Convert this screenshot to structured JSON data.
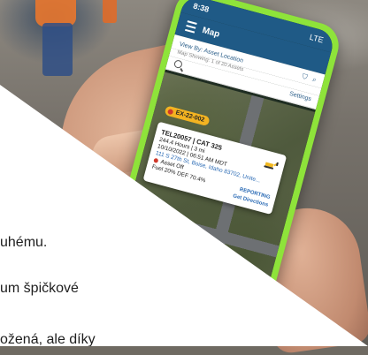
{
  "phone": {
    "status": {
      "time": "8:38",
      "signal": "LTE"
    },
    "appbar": {
      "title": "Map"
    },
    "filter": {
      "view_label": "View By: Asset Location",
      "sub_label": "Map Showing: 1 of 20 Assets",
      "settings_label": "Settings"
    },
    "asset_pill": "EX-22-002",
    "card": {
      "id_line": "TEL20057 | CAT 325",
      "hours_line": "244.4 Hours | 3 mi",
      "date_line": "10/10/2022 | 06:51 AM MDT",
      "address_line": "111 S 27th St, Boise, Idaho 83702, Unite...",
      "status_line": "Asset Off",
      "fuel_line": "Fuel 20%  DEF 70.4%",
      "reporting_label": "REPORTING",
      "directions_label": "Get Directions"
    }
  },
  "overlay": {
    "line1": "uhému.",
    "line2": "um špičkové",
    "line3": "ožená, ale díky"
  }
}
